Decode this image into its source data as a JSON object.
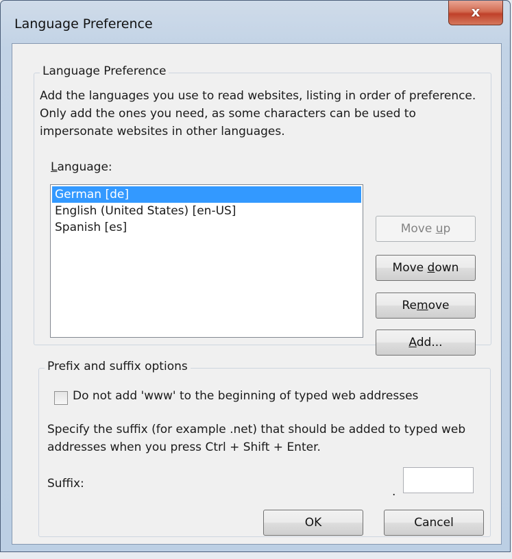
{
  "window": {
    "title": "Language Preference",
    "close_glyph": "x"
  },
  "language_group": {
    "legend": "Language Preference",
    "description": "Add the languages you use to read websites, listing in order of preference. Only add the ones you need, as some characters can be used to impersonate websites in other languages.",
    "language_label": "Language:",
    "languages": [
      {
        "label": "German [de]",
        "selected": true
      },
      {
        "label": "English (United States) [en-US]",
        "selected": false
      },
      {
        "label": "Spanish [es]",
        "selected": false
      }
    ],
    "buttons": {
      "move_up": "Move up",
      "move_down": "Move down",
      "remove": "Remove",
      "add": "Add..."
    }
  },
  "prefix_group": {
    "legend": "Prefix and suffix options",
    "checkbox_label": "Do not add 'www' to the beginning of typed web addresses",
    "checkbox_checked": false,
    "suffix_description": "Specify the suffix (for example .net) that should be added to typed web addresses when you press Ctrl + Shift + Enter.",
    "suffix_label": "Suffix:",
    "suffix_dot": ".",
    "suffix_value": ""
  },
  "footer": {
    "ok": "OK",
    "cancel": "Cancel"
  },
  "colors": {
    "selection": "#3399ff",
    "close_button": "#c0412a"
  }
}
